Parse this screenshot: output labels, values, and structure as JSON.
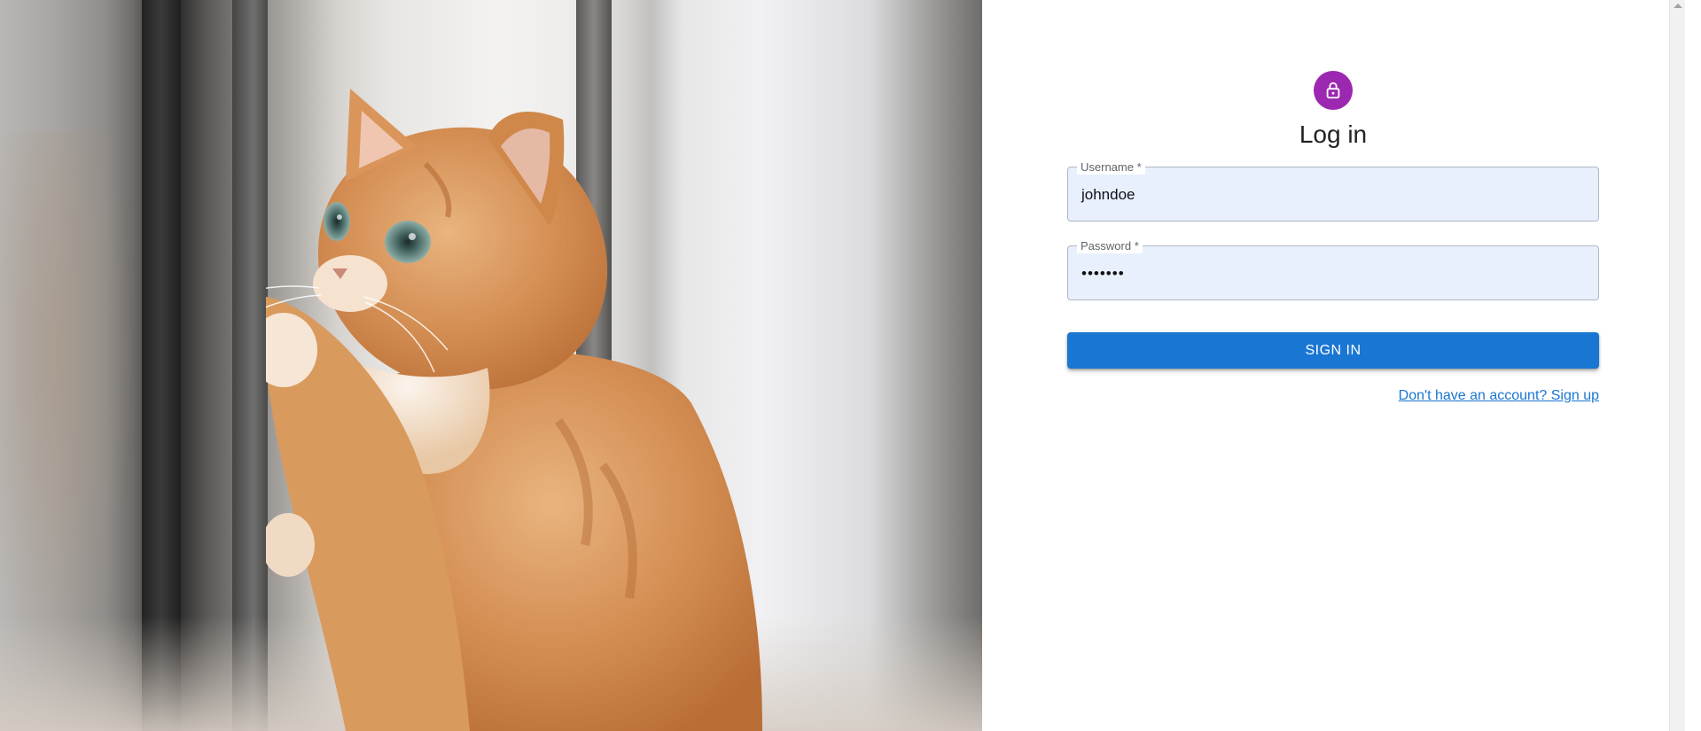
{
  "hero": {
    "image": "cat-looking-out-window-photo"
  },
  "form": {
    "icon": "lock-icon",
    "title": "Log in",
    "username": {
      "label": "Username *",
      "value": "johndoe"
    },
    "password": {
      "label": "Password *",
      "value": "•••••••"
    },
    "submit_label": "SIGN IN",
    "signup_link": "Don't have an account? Sign up"
  },
  "colors": {
    "avatar": "#9c27b0",
    "primary": "#1976d2",
    "field_bg": "#e8f0fe"
  }
}
